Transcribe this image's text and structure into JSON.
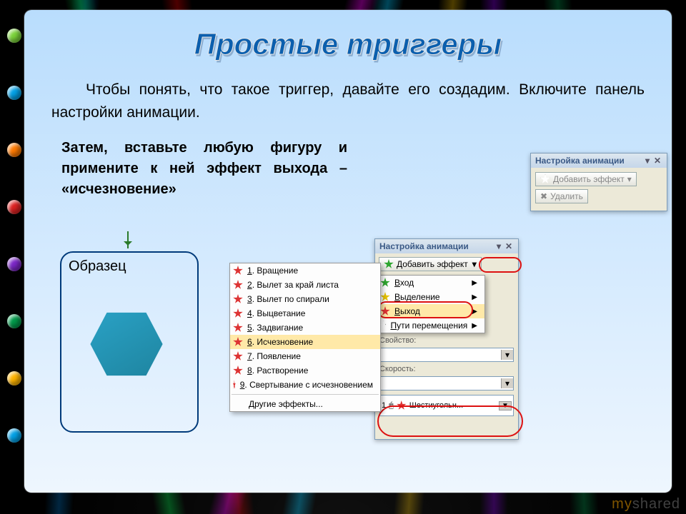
{
  "dots": [
    "#7bd33a",
    "#03a1e6",
    "#ff7a00",
    "#d22",
    "#7c27c7",
    "#009a4a",
    "#ffb400",
    "#03a1e6"
  ],
  "title": "Простые триггеры",
  "para1": "Чтобы понять, что такое триггер, давайте его создадим.  Включите панель настройки анимации.",
  "para2": "Затем, вставьте любую фигуру и примените к ней эффект выхода – «исчезновение»",
  "sample_label": "Образец",
  "panel_right": {
    "title": "Настройка анимации",
    "add": "Добавить эффект",
    "del": "Удалить"
  },
  "panel_main": {
    "title": "Настройка анимации",
    "add": "Добавить эффект",
    "sub": [
      {
        "k": "Вход",
        "star": "green"
      },
      {
        "k": "Выделение",
        "star": "yellow"
      },
      {
        "k": "Выход",
        "star": "red"
      },
      {
        "k": "Пути перемещения",
        "star": "outline"
      }
    ],
    "prop_label": "Свойство:",
    "speed_label": "Скорость:",
    "effect_item": "Шестиугольн...",
    "effect_index": "1"
  },
  "effects_menu": {
    "items": [
      "1. Вращение",
      "2. Вылет за край листа",
      "3. Вылет по спирали",
      "4. Выцветание",
      "5. Задвигание",
      "6. Исчезновение",
      "7. Появление",
      "8. Растворение",
      "9. Свертывание с исчезновением"
    ],
    "more": "Другие эффекты..."
  },
  "watermark": {
    "a": "my",
    "b": "shared"
  }
}
